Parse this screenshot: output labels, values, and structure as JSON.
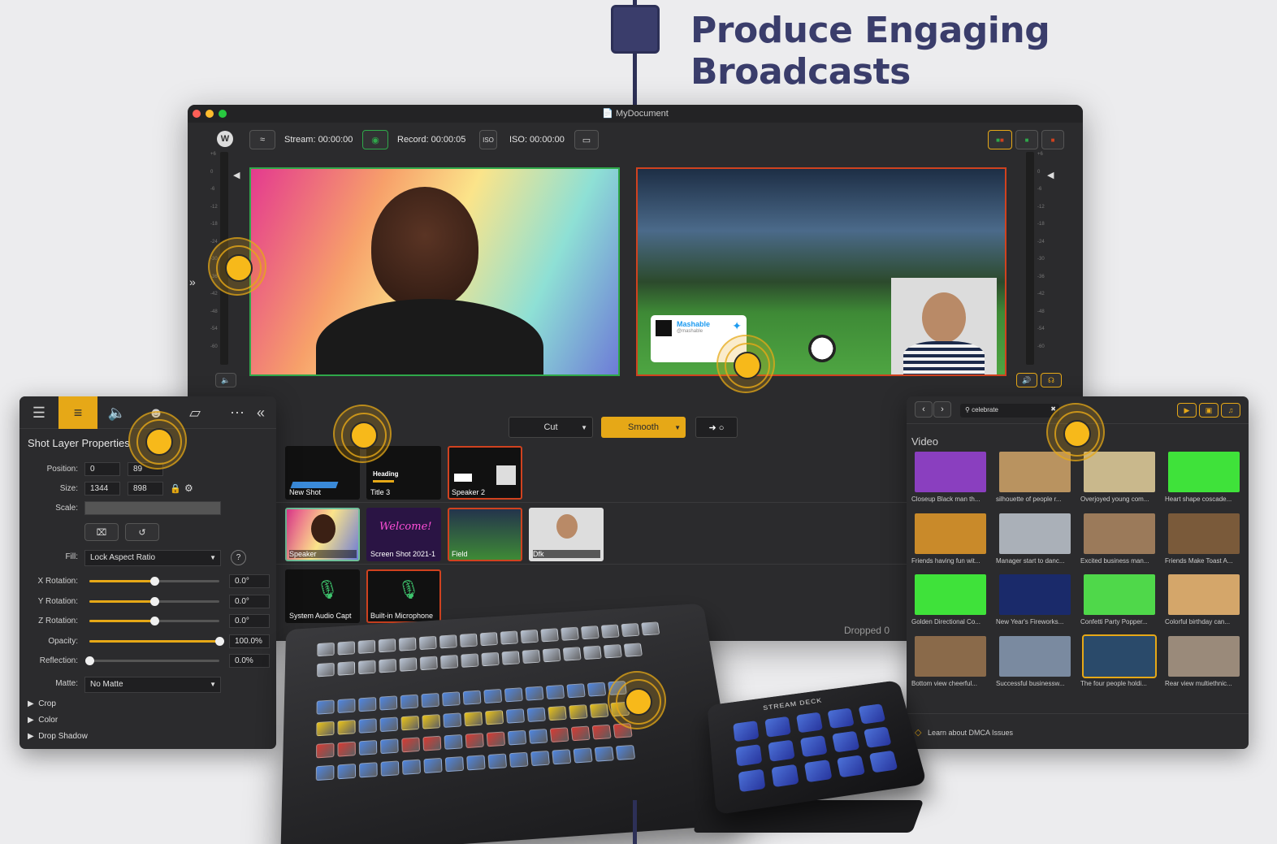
{
  "headline": "Produce Engaging Broadcasts",
  "window": {
    "document_title": "MyDocument",
    "stream_label": "Stream: 00:00:00",
    "record_label": "Record: 00:00:05",
    "iso_label": "ISO: 00:00:00",
    "meter_scale": [
      "+6",
      "0",
      "-6",
      "-12",
      "-18",
      "-24",
      "-30",
      "-36",
      "-42",
      "-48",
      "-54",
      "-60"
    ],
    "transitions": {
      "cut": "Cut",
      "smooth": "Smooth"
    },
    "tweet": {
      "account": "Mashable",
      "handle": "@mashable"
    },
    "shot_rows": [
      [
        "New Shot",
        "Title 3",
        "Speaker 2"
      ],
      [
        "Speaker",
        "Screen Shot 2021-1",
        "Field",
        "Dfk"
      ],
      [
        "System Audio Capt",
        "Built-in Microphone"
      ]
    ],
    "thumb_text": {
      "heading": "Heading",
      "welcome": "Welcome!"
    },
    "dropped": "Dropped 0"
  },
  "props": {
    "title": "Shot Layer Properties",
    "position_label": "Position:",
    "position_x": "0",
    "position_y": "89",
    "size_label": "Size:",
    "size_w": "1344",
    "size_h": "898",
    "scale_label": "Scale:",
    "fill_label": "Fill:",
    "fill_value": "Lock Aspect Ratio",
    "help": "?",
    "sliders": [
      {
        "label": "X Rotation:",
        "value": "0.0°",
        "level": 0.5
      },
      {
        "label": "Y Rotation:",
        "value": "0.0°",
        "level": 0.5
      },
      {
        "label": "Z Rotation:",
        "value": "0.0°",
        "level": 0.5
      },
      {
        "label": "Opacity:",
        "value": "100.0%",
        "level": 1.0
      },
      {
        "label": "Reflection:",
        "value": "0.0%",
        "level": 0.0
      }
    ],
    "matte_label": "Matte:",
    "matte_value": "No Matte",
    "sections": [
      "Crop",
      "Color",
      "Drop Shadow"
    ]
  },
  "media": {
    "search_value": "celebrate",
    "category": "Video",
    "items": [
      "Closeup Black man th...",
      "silhouette of people r...",
      "Overjoyed young com...",
      "Heart shape coscade...",
      "Friends having fun wit...",
      "Manager start to danc...",
      "Excited business man...",
      "Friends Make Toast A...",
      "Golden Directional Co...",
      "New Year's Fireworks...",
      "Confetti Party Popper...",
      "Colorful birthday can...",
      "Bottom view cheerful...",
      "Successful businessw...",
      "The four people holdi...",
      "Rear view multiethnic..."
    ],
    "footer": "Learn about DMCA Issues"
  },
  "hardware": {
    "streamdeck_brand": "STREAM DECK"
  },
  "colors": {
    "accent": "#e6a817",
    "live_green": "#2fa84a",
    "live_red": "#d0421f",
    "brand_navy": "#3a3d6b"
  }
}
